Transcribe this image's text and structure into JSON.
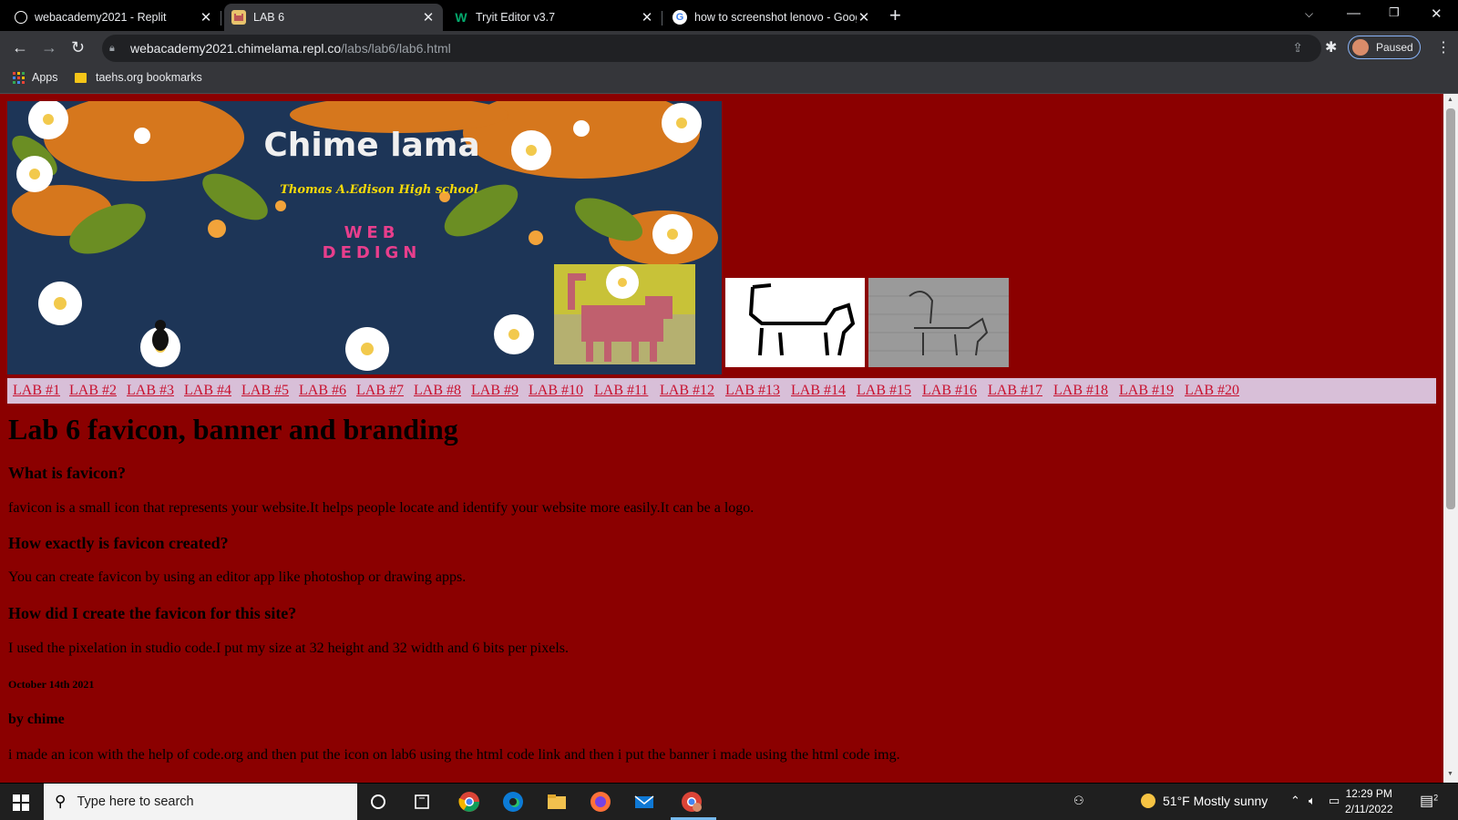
{
  "browser": {
    "tabs": [
      {
        "title": "webacademy2021 - Replit",
        "icon": "replit-icon",
        "active": false
      },
      {
        "title": "LAB 6",
        "icon": "cat-favicon",
        "active": true
      },
      {
        "title": "Tryit Editor v3.7",
        "icon": "w3schools-icon",
        "active": false
      },
      {
        "title": "how to screenshot lenovo - Goog",
        "icon": "google-icon",
        "active": false
      }
    ],
    "url_host": "webacademy2021.chimelama.repl.co",
    "url_path": "/labs/lab6/lab6.html",
    "profile_status": "Paused",
    "bookmarks": [
      {
        "label": "Apps"
      },
      {
        "label": "taehs.org bookmarks"
      }
    ]
  },
  "page": {
    "banner": {
      "title": "Chime lama",
      "school": "Thomas A.Edison High school",
      "line1": "WEB",
      "line2": "DEDIGN"
    },
    "nav_links": [
      "LAB #1",
      "LAB #2",
      "LAB #3",
      "LAB #4",
      "LAB #5",
      "LAB #6",
      "LAB #7",
      "LAB #8",
      "LAB #9",
      "LAB #10",
      "LAB #11",
      "LAB #12",
      "LAB #13",
      "LAB #14",
      "LAB #15",
      "LAB #16",
      "LAB #17",
      "LAB #18",
      "LAB #19",
      "LAB #20"
    ],
    "heading": "Lab 6 favicon, banner and branding",
    "sections": [
      {
        "question": "What is favicon?",
        "answer": "favicon is a small icon that represents your website.It helps people locate and identify your website more easily.It can be a logo."
      },
      {
        "question": "How exactly is favicon created?",
        "answer": "You can create favicon by using an editor app like photoshop or drawing apps."
      },
      {
        "question": "How did I create the favicon for this site?",
        "answer": "I used the pixelation in studio code.I put my size at 32 height and 32 width and 6 bits per pixels."
      }
    ],
    "date": "October 14th 2021",
    "author": "by chime",
    "last_paragraph": "i made an icon with the help of code.org and then put the icon on lab6 using the html code link and then i put the banner i made using the html code img."
  },
  "taskbar": {
    "search_placeholder": "Type here to search",
    "weather": "51°F  Mostly sunny",
    "time": "12:29 PM",
    "date": "2/11/2022",
    "notification_count": "2"
  },
  "colors": {
    "page_bg": "#8b0000",
    "navbar_bg": "#d8bfd8",
    "link": "#c8102e",
    "banner_bg": "#1d3557"
  }
}
